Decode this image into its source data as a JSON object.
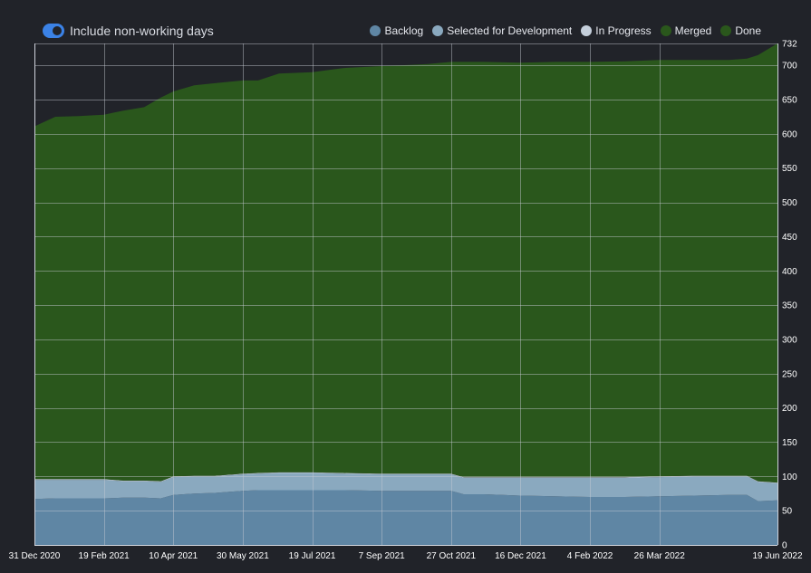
{
  "toolbar": {
    "toggle_label": "Include non-working days",
    "toggle_on": true
  },
  "colors": {
    "background": "#212329",
    "toggle": "#3b82e6",
    "grid": "#c8ccd4",
    "backlog": "#5f86a4",
    "selected": "#8aa9bf",
    "in_progress": "#c5cfdb",
    "merged": "#2a571c",
    "done": "#2a571c"
  },
  "chart_data": {
    "type": "area",
    "stacked": true,
    "title": "",
    "xlabel": "",
    "ylabel": "",
    "x_ticks": [
      "31 Dec 2020",
      "19 Feb 2021",
      "10 Apr 2021",
      "30 May 2021",
      "19 Jul 2021",
      "7 Sep 2021",
      "27 Oct 2021",
      "16 Dec 2021",
      "4 Feb 2022",
      "26 Mar 2022",
      "19 Jun 2022"
    ],
    "y_ticks": [
      0,
      50,
      100,
      150,
      200,
      250,
      300,
      350,
      400,
      450,
      500,
      550,
      600,
      650,
      700,
      732
    ],
    "ylim": [
      0,
      732
    ],
    "xlim": [
      "2020-12-31",
      "2022-06-19"
    ],
    "legend_position": "top-right",
    "grid": true,
    "x": [
      "2020-12-31",
      "2021-01-15",
      "2021-02-01",
      "2021-02-19",
      "2021-03-05",
      "2021-03-20",
      "2021-04-01",
      "2021-04-10",
      "2021-04-25",
      "2021-05-10",
      "2021-05-30",
      "2021-06-10",
      "2021-06-25",
      "2021-07-19",
      "2021-08-10",
      "2021-09-07",
      "2021-09-20",
      "2021-10-10",
      "2021-10-27",
      "2021-11-05",
      "2021-11-20",
      "2021-12-16",
      "2022-01-10",
      "2022-02-04",
      "2022-03-01",
      "2022-03-26",
      "2022-04-20",
      "2022-05-15",
      "2022-05-28",
      "2022-06-05",
      "2022-06-19"
    ],
    "series": [
      {
        "name": "Backlog",
        "color": "#5f86a4",
        "values": [
          67,
          68,
          68,
          68,
          69,
          69,
          68,
          73,
          75,
          76,
          79,
          80,
          80,
          80,
          80,
          79,
          79,
          79,
          79,
          74,
          74,
          72,
          71,
          70,
          70,
          71,
          72,
          73,
          73,
          64,
          65
        ]
      },
      {
        "name": "Selected for Development",
        "color": "#8aa9bf",
        "values": [
          28,
          27,
          27,
          27,
          24,
          24,
          24,
          26,
          25,
          24,
          24,
          24,
          25,
          25,
          24,
          24,
          24,
          24,
          24,
          24,
          24,
          26,
          27,
          28,
          28,
          28,
          28,
          27,
          27,
          28,
          25
        ]
      },
      {
        "name": "In Progress",
        "color": "#c5cfdb",
        "values": [
          1,
          1,
          1,
          1,
          1,
          1,
          1,
          1,
          1,
          1,
          1,
          1,
          1,
          1,
          1,
          1,
          1,
          1,
          1,
          1,
          1,
          1,
          1,
          1,
          1,
          1,
          1,
          1,
          1,
          1,
          1
        ]
      },
      {
        "name": "Merged",
        "color": "#2a571c",
        "values": [
          0,
          0,
          0,
          0,
          0,
          0,
          0,
          0,
          0,
          0,
          0,
          0,
          0,
          0,
          0,
          0,
          0,
          0,
          0,
          0,
          0,
          0,
          0,
          0,
          0,
          0,
          0,
          0,
          0,
          0,
          0
        ]
      },
      {
        "name": "Done",
        "color": "#2a571c",
        "values": [
          515,
          529,
          530,
          532,
          540,
          545,
          560,
          562,
          570,
          573,
          574,
          573,
          582,
          584,
          591,
          595,
          596,
          598,
          601,
          606,
          606,
          605,
          606,
          606,
          607,
          608,
          607,
          607,
          609,
          622,
          641
        ]
      }
    ]
  }
}
